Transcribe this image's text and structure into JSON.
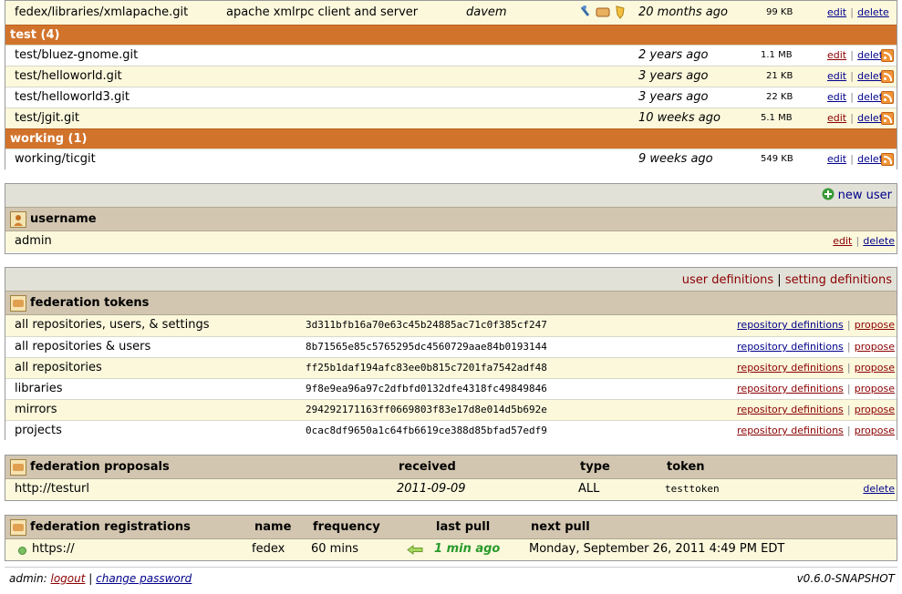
{
  "repos": {
    "top": {
      "name": "fedex/libraries/xmlapache.git",
      "description": "apache xmlrpc client and server",
      "owner": "davem",
      "age": "20 months ago",
      "size": "99 KB",
      "edit": "edit",
      "sep": "|",
      "delete": "delete"
    },
    "groups": [
      {
        "label": "test (4)",
        "items": [
          {
            "name": "test/bluez-gnome.git",
            "age": "2 years ago",
            "size": "1.1 MB"
          },
          {
            "name": "test/helloworld.git",
            "age": "3 years ago",
            "size": "21 KB"
          },
          {
            "name": "test/helloworld3.git",
            "age": "3 years ago",
            "size": "22 KB"
          },
          {
            "name": "test/jgit.git",
            "age": "10 weeks ago",
            "size": "5.1 MB"
          }
        ]
      },
      {
        "label": "working (1)",
        "items": [
          {
            "name": "working/ticgit",
            "age": "9 weeks ago",
            "size": "549 KB"
          }
        ]
      }
    ],
    "edit": "edit",
    "sep": "|",
    "delete": "delete"
  },
  "users": {
    "new_user": "new user",
    "header": "username",
    "rows": [
      {
        "name": "admin",
        "edit": "edit",
        "sep": "|",
        "delete": "delete"
      }
    ]
  },
  "tokens": {
    "links": {
      "user_definitions": "user definitions",
      "sep": "|",
      "setting_definitions": "setting definitions"
    },
    "header": "federation tokens",
    "rows": [
      {
        "name": "all repositories, users, & settings",
        "token": "3d311bfb16a70e63c45b24885ac71c0f385cf247"
      },
      {
        "name": "all repositories & users",
        "token": "8b71565e85c5765295dc4560729aae84b0193144"
      },
      {
        "name": "all repositories",
        "token": "ff25b1daf194afc83ee0b815c7201fa7542adf48"
      },
      {
        "name": "libraries",
        "token": "9f8e9ea96a97c2dfbfd0132dfe4318fc49849846"
      },
      {
        "name": "mirrors",
        "token": "294292171163ff0669803f83e17d8e014d5b692e"
      },
      {
        "name": "projects",
        "token": "0cac8df9650a1c64fb6619ce388d85bfad57edf9"
      }
    ],
    "repo_def": "repository definitions",
    "sep": "|",
    "propose": "propose"
  },
  "proposals": {
    "header": "federation proposals",
    "col_received": "received",
    "col_type": "type",
    "col_token": "token",
    "rows": [
      {
        "url": "http://testurl",
        "received": "2011-09-09",
        "type": "ALL",
        "token": "testtoken",
        "delete": "delete"
      }
    ]
  },
  "registrations": {
    "header": "federation registrations",
    "col_name": "name",
    "col_frequency": "frequency",
    "col_last": "last pull",
    "col_next": "next pull",
    "rows": [
      {
        "url": "https://",
        "name": "fedex",
        "frequency": "60 mins",
        "last": "1 min ago",
        "next": "Monday, September 26, 2011 4:49 PM EDT"
      }
    ]
  },
  "footer": {
    "user": "admin:",
    "logout": "logout",
    "sep": "|",
    "change_password": "change password",
    "version": "v0.6.0-SNAPSHOT"
  },
  "colors": {
    "group": "#d2732c",
    "header": "#d2c6b0",
    "odd": "#fbf8dc",
    "link": "#00008b",
    "alt_link": "#8b0000",
    "green": "#2a9a2a"
  }
}
